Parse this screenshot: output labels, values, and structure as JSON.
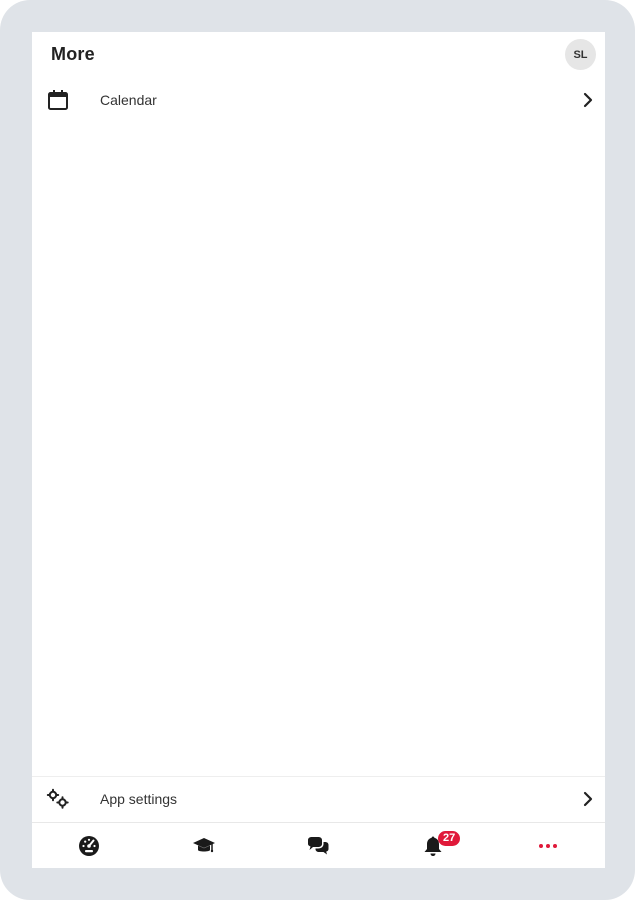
{
  "header": {
    "title": "More",
    "avatar_initials": "SL"
  },
  "menu": {
    "items": [
      {
        "label": "Calendar",
        "icon": "calendar-icon"
      }
    ],
    "footer_item": {
      "label": "App settings",
      "icon": "gears-icon"
    }
  },
  "tabbar": {
    "tabs": [
      {
        "name": "dashboard",
        "icon": "dashboard-icon"
      },
      {
        "name": "courses",
        "icon": "graduation-cap-icon"
      },
      {
        "name": "messages",
        "icon": "chat-bubbles-icon"
      },
      {
        "name": "notifications",
        "icon": "bell-icon",
        "badge": "27"
      },
      {
        "name": "more",
        "icon": "more-dots-icon",
        "active": true
      }
    ]
  },
  "colors": {
    "frame": "#dfe3e8",
    "accent": "#e0193a",
    "icon": "#222222",
    "text": "#333333"
  }
}
